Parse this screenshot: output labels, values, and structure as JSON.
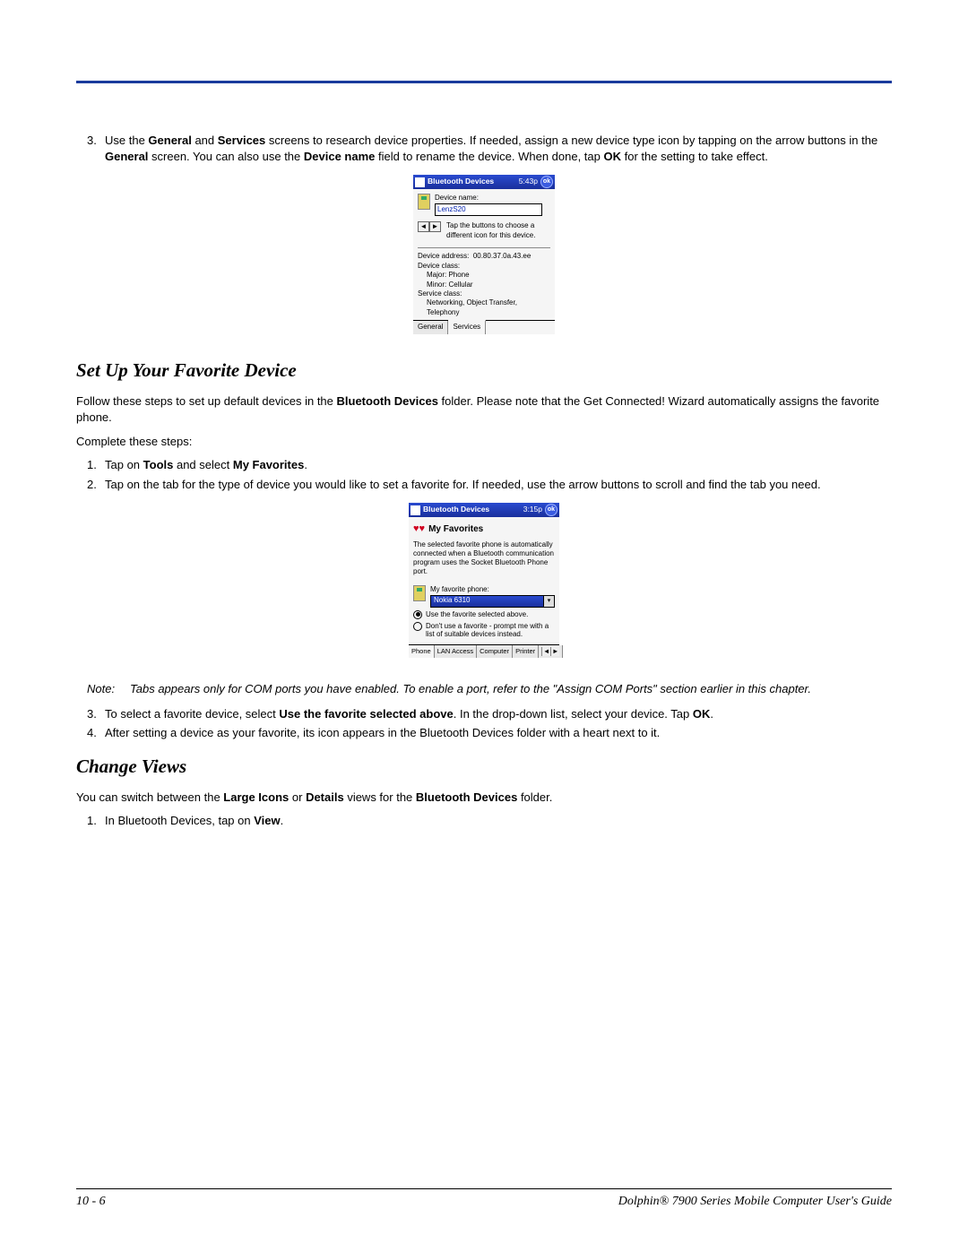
{
  "step3": {
    "num": "3.",
    "pre": "Use the ",
    "b1": "General",
    "mid1": " and ",
    "b2": "Services",
    "mid2": " screens to research device properties. If needed, assign a new device type icon by tapping on the arrow buttons in the ",
    "b3": "General",
    "mid3": " screen. You can also use the ",
    "b4": "Device name",
    "mid4": " field to rename the device. When done, tap ",
    "b5": "OK",
    "post": " for the setting to take effect."
  },
  "pda1": {
    "title": "Bluetooth Devices",
    "time": "5:43p",
    "ok": "ok",
    "dn_label": "Device name:",
    "dn_value": "LenzS20",
    "arrow_text": "Tap the buttons to choose a different icon for this device.",
    "addr_label": "Device address:",
    "addr_value": "00.80.37.0a.43.ee",
    "class_label": "Device class:",
    "major": "Major:  Phone",
    "minor": "Minor:  Cellular",
    "svc_label": "Service class:",
    "svc_value": "Networking, Object Transfer, Telephony",
    "tab1": "General",
    "tab2": "Services"
  },
  "sec_fav": "Set Up Your Favorite Device",
  "fav_intro": {
    "pre": "Follow these steps to set up default devices in the ",
    "b1": "Bluetooth Devices",
    "post": " folder. Please note that the Get Connected! Wizard automatically assigns the favorite phone."
  },
  "complete": "Complete these steps:",
  "fav_s1": {
    "num": "1.",
    "pre": "Tap on ",
    "b1": "Tools",
    "mid": " and select ",
    "b2": "My Favorites",
    "post": "."
  },
  "fav_s2": {
    "num": "2.",
    "txt": "Tap on the tab for the type of device you would like to set a favorite for. If needed, use the arrow buttons to scroll and find the tab you need."
  },
  "pda2": {
    "title": "Bluetooth Devices",
    "time": "3:15p",
    "ok": "ok",
    "myfav": "My Favorites",
    "desc": "The selected favorite phone is automatically connected when a Bluetooth communication program uses the Socket Bluetooth Phone port.",
    "fav_label": "My favorite phone:",
    "fav_value": "Nokia 6310",
    "radio1": "Use the favorite selected above.",
    "radio2": "Don't use a favorite - prompt me with a list of suitable devices instead.",
    "tabs": [
      "Phone",
      "LAN Access",
      "Computer",
      "Printer"
    ]
  },
  "note": {
    "label": "Note:",
    "txt": "Tabs appears only for COM ports you have enabled. To enable a port, refer to the \"Assign COM Ports\" section earlier in this chapter."
  },
  "fav_s3": {
    "num": "3.",
    "pre": "To select a favorite device, select ",
    "b1": "Use the favorite selected above",
    "mid": ". In the drop-down list, select your device. Tap ",
    "b2": "OK",
    "post": "."
  },
  "fav_s4": {
    "num": "4.",
    "txt": "After setting a device as your favorite, its icon appears in the Bluetooth Devices folder with a heart next to it."
  },
  "sec_views": "Change Views",
  "views_intro": {
    "pre": "You can switch between the ",
    "b1": "Large Icons",
    "mid1": " or ",
    "b2": "Details",
    "mid2": " views for the ",
    "b3": "Bluetooth Devices",
    "post": " folder."
  },
  "views_s1": {
    "num": "1.",
    "pre": "In Bluetooth Devices, tap on ",
    "b1": "View",
    "post": "."
  },
  "footer": {
    "page": "10 - 6",
    "guide": "Dolphin® 7900 Series Mobile Computer User's Guide"
  }
}
